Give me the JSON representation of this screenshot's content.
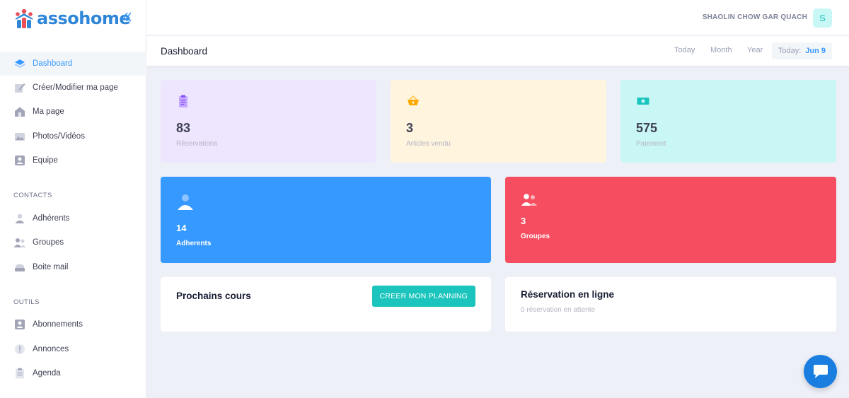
{
  "brand": {
    "name": "assohome"
  },
  "header": {
    "user_name": "SHAOLIN CHOW GAR QUACH",
    "avatar_initial": "S"
  },
  "subheader": {
    "title": "Dashboard",
    "filters": [
      "Today",
      "Month",
      "Year"
    ],
    "date_label": "Today:",
    "date_value": "Jun 9"
  },
  "sidebar": {
    "items": [
      {
        "label": "Dashboard",
        "icon": "dashboard-layers-icon",
        "active": true
      },
      {
        "label": "Créer/Modifier ma page",
        "icon": "edit-pencil-icon"
      },
      {
        "label": "Ma page",
        "icon": "home-icon"
      },
      {
        "label": "Photos/Vidéos",
        "icon": "photos-icon"
      },
      {
        "label": "Equipe",
        "icon": "team-icon"
      }
    ],
    "contacts_title": "CONTACTS",
    "contacts": [
      {
        "label": "Adhérents",
        "icon": "user-icon"
      },
      {
        "label": "Groupes",
        "icon": "users-icon"
      },
      {
        "label": "Boite mail",
        "icon": "mailbox-icon"
      }
    ],
    "outils_title": "OUTILS",
    "outils": [
      {
        "label": "Abonnements",
        "icon": "subscription-icon"
      },
      {
        "label": "Annonces",
        "icon": "announcement-icon"
      },
      {
        "label": "Agenda",
        "icon": "clipboard-icon"
      }
    ]
  },
  "stats": {
    "reservations": {
      "value": "83",
      "label": "Réservations",
      "icon": "clipboard-list-icon"
    },
    "articles": {
      "value": "3",
      "label": "Articles vendu",
      "icon": "basket-icon"
    },
    "paiement": {
      "value": "575",
      "label": "Paiement",
      "icon": "money-icon"
    },
    "adherents": {
      "value": "14",
      "label": "Adherents",
      "icon": "user-icon"
    },
    "groupes": {
      "value": "3",
      "label": "Groupes",
      "icon": "users-icon"
    }
  },
  "panels": {
    "cours": {
      "title": "Prochains cours",
      "button": "CREER MON PLANNING"
    },
    "reservation": {
      "title": "Réservation en ligne",
      "subtitle": "0 réservation en attente"
    }
  },
  "colors": {
    "primary": "#3699ff",
    "danger": "#f64e60",
    "teal": "#1bc5bd",
    "light_purple": "#eee5ff",
    "light_yellow": "#fff4de",
    "light_teal": "#c9f7f5"
  }
}
